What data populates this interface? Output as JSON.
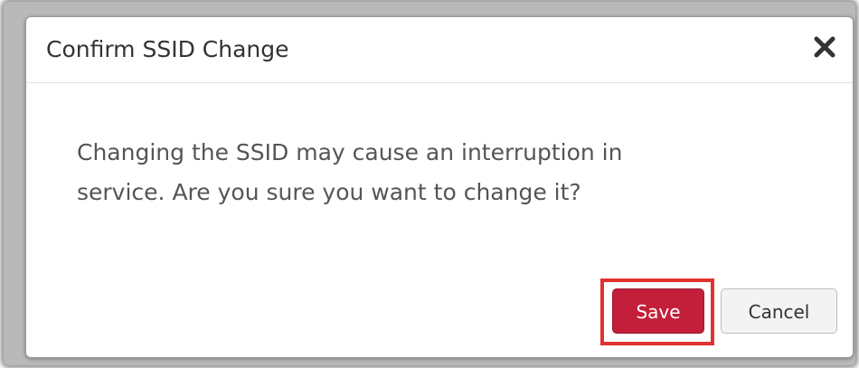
{
  "dialog": {
    "title": "Confirm SSID Change",
    "close_icon": "close-icon",
    "message_line1": "Changing the SSID may cause an interruption in",
    "message_line2": "service. Are you sure you want to change it?",
    "save_label": "Save",
    "cancel_label": "Cancel"
  },
  "colors": {
    "save_button": "#c31f3a",
    "highlight_box": "#e0332e",
    "cancel_button": "#f3f3f3"
  }
}
